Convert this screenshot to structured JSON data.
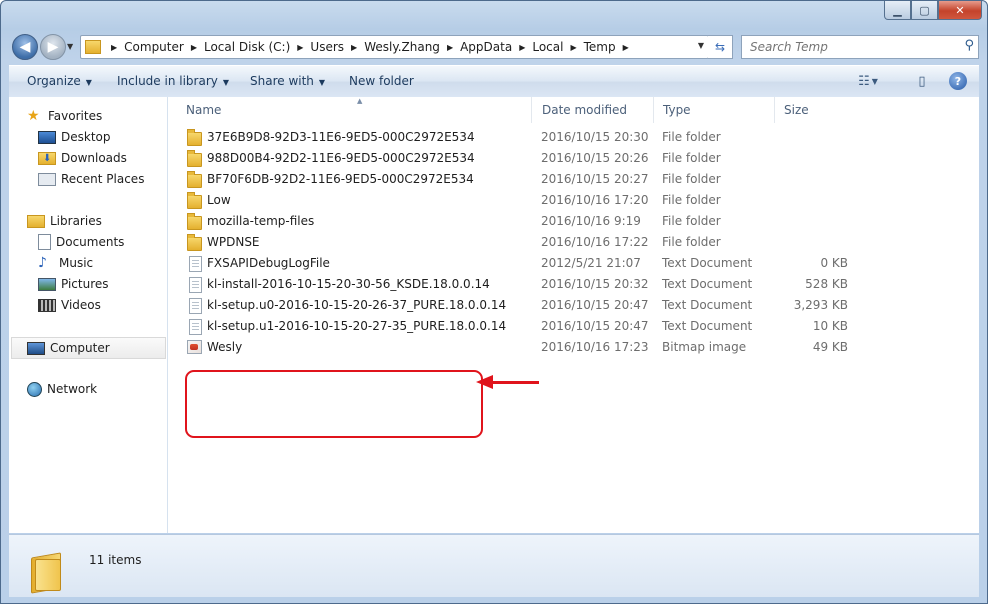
{
  "window": {
    "controls": {
      "min_label": "",
      "max_label": "",
      "close_label": ""
    }
  },
  "nav": {
    "back_glyph": "◀",
    "forward_glyph": "▶"
  },
  "address": {
    "crumbs": [
      "Computer",
      "Local Disk (C:)",
      "Users",
      "Wesly.Zhang",
      "AppData",
      "Local",
      "Temp"
    ]
  },
  "search": {
    "placeholder": "Search Temp"
  },
  "toolbar": {
    "organize": "Organize",
    "include_in_library": "Include in library",
    "share_with": "Share with",
    "new_folder": "New folder"
  },
  "sidebar": {
    "favorites": {
      "label": "Favorites",
      "items": [
        "Desktop",
        "Downloads",
        "Recent Places"
      ]
    },
    "libraries": {
      "label": "Libraries",
      "items": [
        "Documents",
        "Music",
        "Pictures",
        "Videos"
      ]
    },
    "computer": "Computer",
    "network": "Network"
  },
  "columns": {
    "name": "Name",
    "date": "Date modified",
    "type": "Type",
    "size": "Size"
  },
  "files": [
    {
      "icon": "folder-icon",
      "name": "37E6B9D8-92D3-11E6-9ED5-000C2972E534",
      "date": "2016/10/15 20:30",
      "type": "File folder",
      "size": ""
    },
    {
      "icon": "folder-icon",
      "name": "988D00B4-92D2-11E6-9ED5-000C2972E534",
      "date": "2016/10/15 20:26",
      "type": "File folder",
      "size": ""
    },
    {
      "icon": "folder-icon",
      "name": "BF70F6DB-92D2-11E6-9ED5-000C2972E534",
      "date": "2016/10/15 20:27",
      "type": "File folder",
      "size": ""
    },
    {
      "icon": "folder-icon",
      "name": "Low",
      "date": "2016/10/16 17:20",
      "type": "File folder",
      "size": ""
    },
    {
      "icon": "folder-icon",
      "name": "mozilla-temp-files",
      "date": "2016/10/16 9:19",
      "type": "File folder",
      "size": ""
    },
    {
      "icon": "folder-icon",
      "name": "WPDNSE",
      "date": "2016/10/16 17:22",
      "type": "File folder",
      "size": ""
    },
    {
      "icon": "text-document-icon",
      "name": "FXSAPIDebugLogFile",
      "date": "2012/5/21 21:07",
      "type": "Text Document",
      "size": "0 KB"
    },
    {
      "icon": "text-document-icon",
      "name": "kl-install-2016-10-15-20-30-56_KSDE.18.0.0.14",
      "date": "2016/10/15 20:32",
      "type": "Text Document",
      "size": "528 KB"
    },
    {
      "icon": "text-document-icon",
      "name": "kl-setup.u0-2016-10-15-20-26-37_PURE.18.0.0.14",
      "date": "2016/10/15 20:47",
      "type": "Text Document",
      "size": "3,293 KB"
    },
    {
      "icon": "text-document-icon",
      "name": "kl-setup.u1-2016-10-15-20-27-35_PURE.18.0.0.14",
      "date": "2016/10/15 20:47",
      "type": "Text Document",
      "size": "10 KB"
    },
    {
      "icon": "bitmap-image-icon",
      "name": "Wesly",
      "date": "2016/10/16 17:23",
      "type": "Bitmap image",
      "size": "49 KB"
    }
  ],
  "status": {
    "count": "11 items"
  },
  "colors": {
    "annotation": "#e0141c",
    "chrome": "#bfd3ea"
  }
}
